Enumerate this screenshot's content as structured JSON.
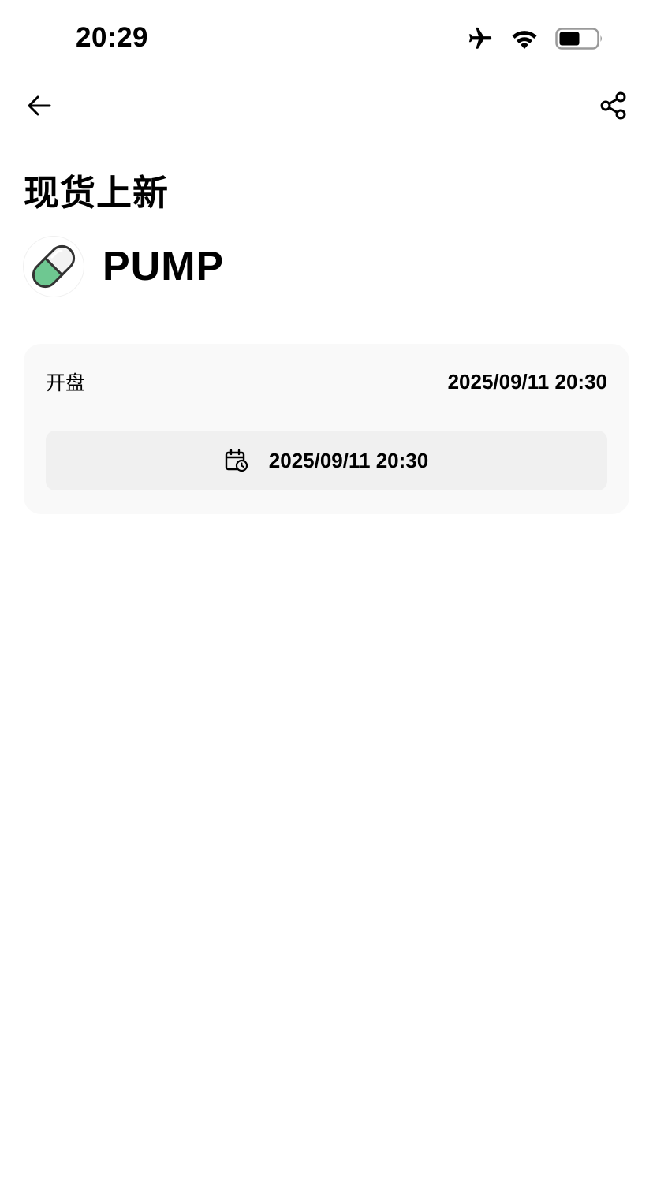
{
  "status_bar": {
    "time": "20:29",
    "icons": [
      "airplane-icon",
      "wifi-icon",
      "battery-icon"
    ]
  },
  "nav": {
    "back_icon": "arrow-left-icon",
    "share_icon": "share-icon"
  },
  "page": {
    "title": "现货上新"
  },
  "token": {
    "name": "PUMP",
    "logo_icon": "pill-icon",
    "logo_colors": {
      "green": "#6ec891",
      "white": "#f2f2f2",
      "outline": "#333333"
    }
  },
  "listing": {
    "open_label": "开盘",
    "open_time": "2025/09/11 20:30",
    "calendar_icon": "calendar-clock-icon",
    "calendar_button_label": "2025/09/11 20:30"
  },
  "colors": {
    "card_bg": "#f9f9f9",
    "button_bg": "#f0f0f0",
    "text": "#000000"
  }
}
